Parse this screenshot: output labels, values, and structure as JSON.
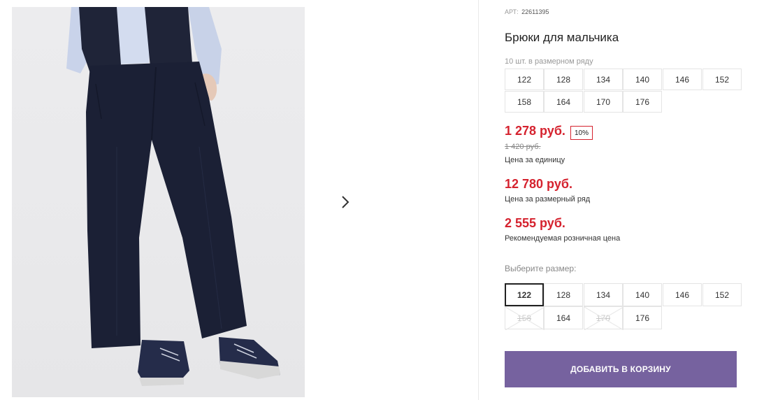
{
  "product": {
    "sku_label": "АРТ:",
    "sku": "22611395",
    "title": "Брюки для мальчика",
    "row_note": "10 шт. в размерном ряду",
    "row_sizes": [
      "122",
      "128",
      "134",
      "140",
      "146",
      "152",
      "158",
      "164",
      "170",
      "176"
    ]
  },
  "prices": {
    "unit_price": "1 278 руб.",
    "discount": "10%",
    "old_price": "1 420 руб.",
    "unit_caption": "Цена за единицу",
    "row_price": "12 780 руб.",
    "row_caption": "Цена за размерный ряд",
    "retail_price": "2 555 руб.",
    "retail_caption": "Рекомендуемая розничная цена"
  },
  "size_select": {
    "label": "Выберите размер:",
    "options": [
      {
        "size": "122",
        "state": "selected"
      },
      {
        "size": "128",
        "state": "available"
      },
      {
        "size": "134",
        "state": "available"
      },
      {
        "size": "140",
        "state": "available"
      },
      {
        "size": "146",
        "state": "available"
      },
      {
        "size": "152",
        "state": "available"
      },
      {
        "size": "158",
        "state": "unavailable"
      },
      {
        "size": "164",
        "state": "available"
      },
      {
        "size": "170",
        "state": "unavailable"
      },
      {
        "size": "176",
        "state": "available"
      }
    ]
  },
  "cart": {
    "add_label": "ДОБАВИТЬ В КОРЗИНУ"
  },
  "gallery": {
    "next_icon": "chevron-right-icon"
  },
  "colors": {
    "price_red": "#d5222e",
    "button_purple": "#76629f",
    "border": "#e4e4e4",
    "pants_navy": "#1b2035"
  }
}
